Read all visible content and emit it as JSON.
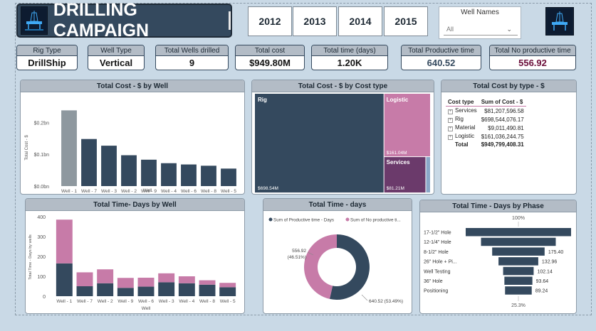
{
  "header": {
    "title": "DRILLING CAMPAIGN",
    "years": [
      "2012",
      "2013",
      "2014",
      "2015"
    ],
    "slicer": {
      "label": "Well Names",
      "value": "All"
    }
  },
  "kpis": [
    {
      "label": "Rig Type",
      "value": "DrillShip",
      "color": "#111111"
    },
    {
      "label": "Well Type",
      "value": "Vertical",
      "color": "#111111"
    },
    {
      "label": "Total Wells drilled",
      "value": "9",
      "color": "#111111"
    },
    {
      "label": "Total cost",
      "value": "$949.80M",
      "color": "#111111"
    },
    {
      "label": "Total time (days)",
      "value": "1.20K",
      "color": "#111111"
    },
    {
      "label": "Total Productive time",
      "value": "640.52",
      "color": "#34495e"
    },
    {
      "label": "Total No productive time",
      "value": "556.92",
      "color": "#6b0f3a"
    }
  ],
  "colors": {
    "navy": "#34495e",
    "pink": "#c77ba8",
    "grey": "#8e989f",
    "purple": "#6b3a6b",
    "blue": "#8aa7c8"
  },
  "cost_by_well": {
    "title": "Total Cost - $ by Well",
    "xlabel": "Well",
    "ylabel": "Total Cost - $",
    "chart_data": {
      "type": "bar",
      "categories": [
        "Well - 1",
        "Well - 7",
        "Well - 3",
        "Well - 2",
        "Well - 9",
        "Well - 4",
        "Well - 6",
        "Well - 8",
        "Well - 5"
      ],
      "values": [
        0.238,
        0.148,
        0.127,
        0.097,
        0.083,
        0.072,
        0.068,
        0.064,
        0.055
      ],
      "ticks": [
        "$0.2bn",
        "$0.1bn",
        "$0.0bn"
      ],
      "tick_values": [
        0.2,
        0.1,
        0.0
      ],
      "ylim": [
        0,
        0.25
      ]
    }
  },
  "cost_by_type": {
    "title": "Total Cost - $ by Cost type",
    "tiles": [
      {
        "name": "Rig",
        "value_label": "$698.54M",
        "value": 698.54
      },
      {
        "name": "Logistic",
        "value_label": "$161.04M",
        "value": 161.04
      },
      {
        "name": "Services",
        "value_label": "$81.21M",
        "value": 81.21
      },
      {
        "name": "",
        "value_label": "",
        "value": 9.01
      }
    ]
  },
  "cost_table": {
    "title": "Total Cost by type - $",
    "headers": [
      "Cost type",
      "Sum of Cost - $"
    ],
    "rows": [
      {
        "type": "Services",
        "value": "$81,207,596.58"
      },
      {
        "type": "Rig",
        "value": "$698,544,076.17"
      },
      {
        "type": "Material",
        "value": "$9,011,490.81"
      },
      {
        "type": "Logistic",
        "value": "$161,036,244.75"
      }
    ],
    "total_label": "Total",
    "total_value": "$949,799,408.31"
  },
  "time_by_well": {
    "title": "Total Time- Days by Well",
    "xlabel": "Well",
    "ylabel": "Total Time - Days by wells",
    "chart_data": {
      "type": "bar",
      "stacked": true,
      "categories": [
        "Well - 1",
        "Well - 7",
        "Well - 2",
        "Well - 9",
        "Well - 6",
        "Well - 3",
        "Well - 4",
        "Well - 8",
        "Well - 5"
      ],
      "series": [
        {
          "values": [
            165,
            50,
            65,
            42,
            48,
            70,
            65,
            58,
            45
          ]
        },
        {
          "values": [
            220,
            70,
            70,
            50,
            45,
            45,
            35,
            22,
            22
          ]
        }
      ],
      "ticks": [
        "400",
        "300",
        "200",
        "100",
        "0"
      ],
      "tick_values": [
        400,
        300,
        200,
        100,
        0
      ],
      "ylim": [
        0,
        400
      ]
    }
  },
  "time_donut": {
    "title": "Total Time - days",
    "legend": [
      "Sum of Productive time - Days",
      "Sum of No productive ti..."
    ],
    "chart_data": {
      "type": "pie",
      "labels": [
        "Sum of Productive time - Days",
        "Sum of No productive time"
      ],
      "values": [
        640.52,
        556.92
      ],
      "label_texts": [
        "640.52 (53.49%)",
        "556.92",
        "(46.51%)"
      ]
    }
  },
  "phase_funnel": {
    "title": "Total Time - Days by Phase",
    "top_label": "100%",
    "bottom_label": "25.3%",
    "chart_data": {
      "type": "bar",
      "orientation": "funnel",
      "categories": [
        "17-1/2\" Hole",
        "12-1/4\" Hole",
        "8-1/2\" Hole",
        "26\" Hole + Pi...",
        "Well Testing",
        "36\" Hole",
        "Positioning"
      ],
      "values": [
        352.5,
        250.0,
        175.4,
        132.96,
        102.14,
        93.64,
        89.24
      ],
      "value_labels": [
        "",
        "",
        "175.40",
        "132.96",
        "102.14",
        "93.64",
        "89.24"
      ]
    }
  }
}
